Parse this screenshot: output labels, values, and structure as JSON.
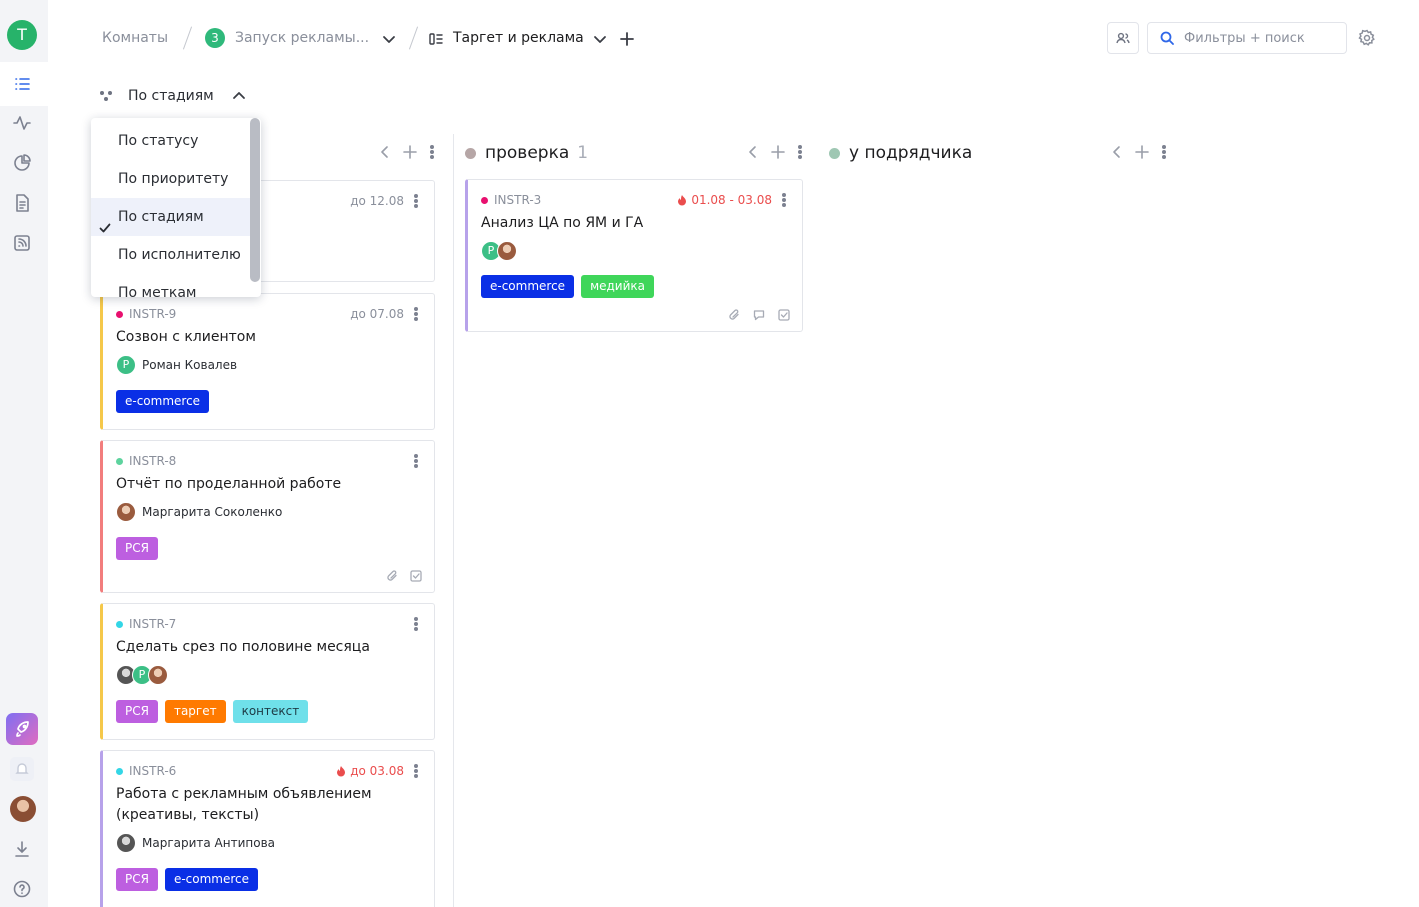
{
  "app": {
    "avatar_letter": "T",
    "brand_color": "#27b36a",
    "accent": "#2f67e8"
  },
  "rail": {
    "icons": [
      "list-icon",
      "activity-icon",
      "pie-chart-icon",
      "document-icon",
      "feed-icon",
      "rocket-icon",
      "bell-icon",
      "user-avatar",
      "download-icon",
      "help-icon"
    ]
  },
  "breadcrumb": {
    "rooms": "Комнаты",
    "project_count": "3",
    "project": "Запуск рекламы...",
    "board": "Таргет и реклама"
  },
  "search": {
    "placeholder": "Фильтры + поиск"
  },
  "groupby": {
    "current": "По стадиям",
    "options": [
      "По статусу",
      "По приоритету",
      "По стадиям",
      "По исполнителю",
      "По меткам"
    ],
    "selected_index": 2
  },
  "columns": [
    {
      "name": "",
      "count": "",
      "color": "#ffffff"
    },
    {
      "name": "проверка",
      "count": "1",
      "color": "#b6a6a6"
    },
    {
      "name": "у подрядчика",
      "count": "",
      "color": "#9fc7b3"
    }
  ],
  "cards": [
    {
      "id": "",
      "due": "до 12.08",
      "title": "",
      "assignee": "",
      "tags": [],
      "border": "#c8c8c8"
    },
    {
      "id": "INSTR-9",
      "priority_color": "#e8106f",
      "due": "до 07.08",
      "title": "Созвон с клиентом",
      "assignee": "Роман Ковалев",
      "avatar_letter": "Р",
      "tags": [
        "e-commerce"
      ],
      "border": "#f5c84a"
    },
    {
      "id": "INSTR-8",
      "priority_color": "#5dd39e",
      "due": "",
      "title": "Отчёт по проделанной работе",
      "assignee": "Маргарита Соколенко",
      "tags": [
        "РСЯ"
      ],
      "border": "#f27d7d"
    },
    {
      "id": "INSTR-7",
      "priority_color": "#33d6e6",
      "due": "",
      "title": "Сделать срез по половине месяца",
      "assignee": "",
      "tags": [
        "РСЯ",
        "таргет",
        "контекст"
      ],
      "border": "#f5c84a"
    },
    {
      "id": "INSTR-6",
      "priority_color": "#33d6e6",
      "due": "до 03.08",
      "due_hot": true,
      "title_line1": "Работа с рекламным объявлением",
      "title_line2": "(креативы, тексты)",
      "assignee": "Маргарита Антипова",
      "tags": [
        "РСЯ",
        "e-commerce"
      ],
      "border": "#b7a2ea"
    },
    {
      "id": "INSTR-3",
      "priority_color": "#e8106f",
      "due": "01.08 - 03.08",
      "due_hot": true,
      "title": "Анализ ЦА по ЯМ и ГА",
      "assignee": "",
      "avatar_letter": "Р",
      "tags": [
        "e-commerce",
        "медийка"
      ],
      "border": "#b7a2ea"
    }
  ],
  "tag_colors": {
    "e-commerce": "#0a2fe6",
    "РСЯ": "#bd5fe0",
    "таргет": "#ff7a00",
    "контекст": "#6fe0ea",
    "медийка": "#3fd65a"
  }
}
